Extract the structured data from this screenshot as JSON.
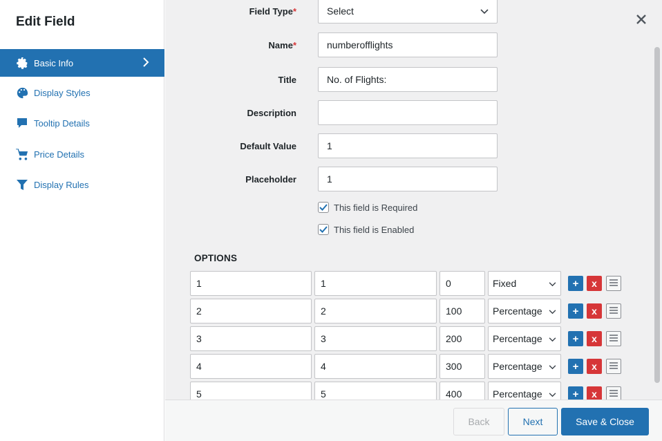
{
  "sidebar": {
    "title": "Edit Field",
    "items": [
      {
        "label": "Basic Info",
        "icon": "gear-icon"
      },
      {
        "label": "Display Styles",
        "icon": "palette-icon"
      },
      {
        "label": "Tooltip Details",
        "icon": "speech-bubble-icon"
      },
      {
        "label": "Price Details",
        "icon": "cart-icon"
      },
      {
        "label": "Display Rules",
        "icon": "filter-icon"
      }
    ]
  },
  "form": {
    "field_type": {
      "label": "Field Type",
      "value": "Select"
    },
    "name": {
      "label": "Name",
      "value": "numberofflights"
    },
    "title": {
      "label": "Title",
      "value": "No. of Flights:"
    },
    "description": {
      "label": "Description",
      "value": ""
    },
    "default_value": {
      "label": "Default Value",
      "value": "1"
    },
    "placeholder": {
      "label": "Placeholder",
      "value": "1"
    },
    "required": {
      "label": "This field is Required",
      "checked": true
    },
    "enabled": {
      "label": "This field is Enabled",
      "checked": true
    }
  },
  "options": {
    "title": "OPTIONS",
    "rows": [
      {
        "value": "1",
        "label": "1",
        "price": "0",
        "type": "Fixed"
      },
      {
        "value": "2",
        "label": "2",
        "price": "100",
        "type": "Percentage"
      },
      {
        "value": "3",
        "label": "3",
        "price": "200",
        "type": "Percentage"
      },
      {
        "value": "4",
        "label": "4",
        "price": "300",
        "type": "Percentage"
      },
      {
        "value": "5",
        "label": "5",
        "price": "400",
        "type": "Percentage"
      }
    ]
  },
  "footer": {
    "back": "Back",
    "next": "Next",
    "save": "Save & Close"
  },
  "colors": {
    "accent": "#2271b1",
    "danger": "#d63638"
  }
}
